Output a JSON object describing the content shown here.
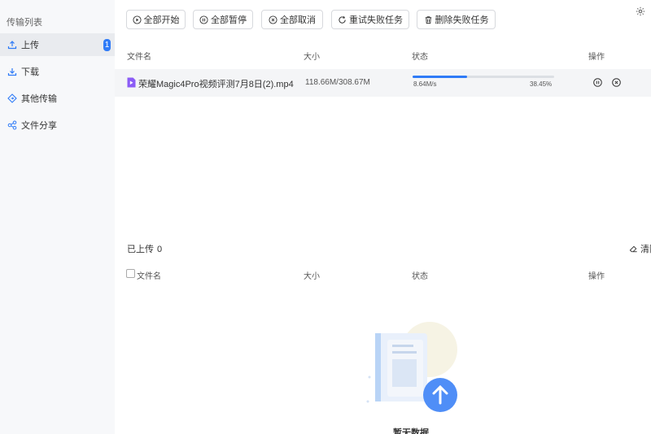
{
  "sidebar": {
    "title": "传输列表",
    "items": [
      {
        "label": "上传",
        "icon": "upload-icon",
        "active": true,
        "badge": "1"
      },
      {
        "label": "下载",
        "icon": "download-icon"
      },
      {
        "label": "其他传输",
        "icon": "transfer-icon"
      },
      {
        "label": "文件分享",
        "icon": "share-icon"
      }
    ]
  },
  "toolbar": {
    "start_all": "全部开始",
    "pause_all": "全部暂停",
    "cancel_all": "全部取消",
    "retry_failed": "重试失败任务",
    "delete_failed": "删除失败任务"
  },
  "table": {
    "columns": [
      "文件名",
      "大小",
      "状态",
      "操作"
    ]
  },
  "uploading": [
    {
      "name": "荣耀Magic4Pro视频评测7月8日(2).mp4",
      "size": "118.66M/308.67M",
      "speed": "8.64M/s",
      "percent": "38.45%",
      "progress": 0.3845
    }
  ],
  "completed": {
    "title": "已上传",
    "count": "0",
    "clear_label": "清除",
    "columns": [
      "文件名",
      "大小",
      "状态",
      "操作"
    ],
    "empty_text": "暂无数据"
  },
  "colors": {
    "accent": "#2f7bf7",
    "sidebar_bg": "#f7f8fa"
  }
}
